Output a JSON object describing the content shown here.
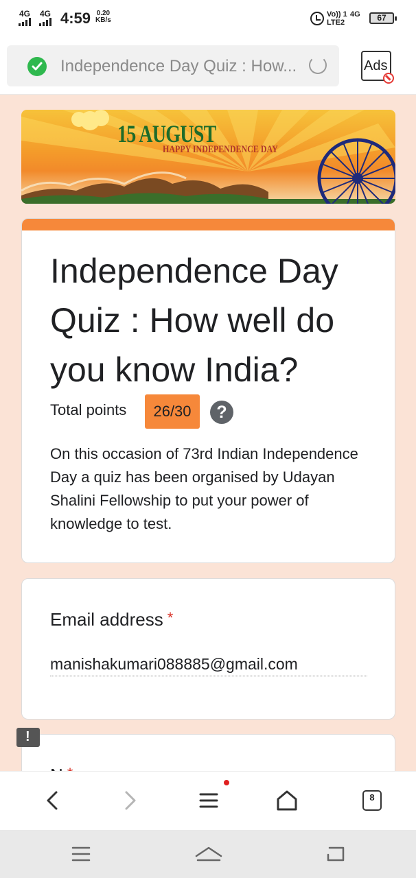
{
  "status_bar": {
    "sim1": "4G",
    "sim2": "4G",
    "time": "4:59",
    "speed_value": "0.20",
    "speed_unit": "KB/s",
    "volte_top": "Vo)) 1",
    "volte_bottom": "LTE2",
    "network_type": "4G",
    "battery": "67"
  },
  "browser": {
    "url_title": "Independence Day Quiz : How...",
    "secure_icon": "shield-check-icon",
    "reload_icon": "reload-icon",
    "ads_label": "Ads",
    "tab_count": "8"
  },
  "banner": {
    "title": "15 AUGUST",
    "subtitle": "HAPPY INDEPENDENCE DAY"
  },
  "form": {
    "accent_color": "#f6883a",
    "title": "Independence Day Quiz : How well do you know India?",
    "points_label": "Total points",
    "points_value": "26/30",
    "help_glyph": "?",
    "description": "On this occasion of  73rd Indian Independence Day a quiz has been organised by Udayan Shalini Fellowship to put your power of knowledge to test."
  },
  "email_question": {
    "label": "Email address",
    "required_mark": "*",
    "value": "manishakumari088885@gmail.com"
  },
  "name_question": {
    "label": "N",
    "required_mark": "*"
  }
}
